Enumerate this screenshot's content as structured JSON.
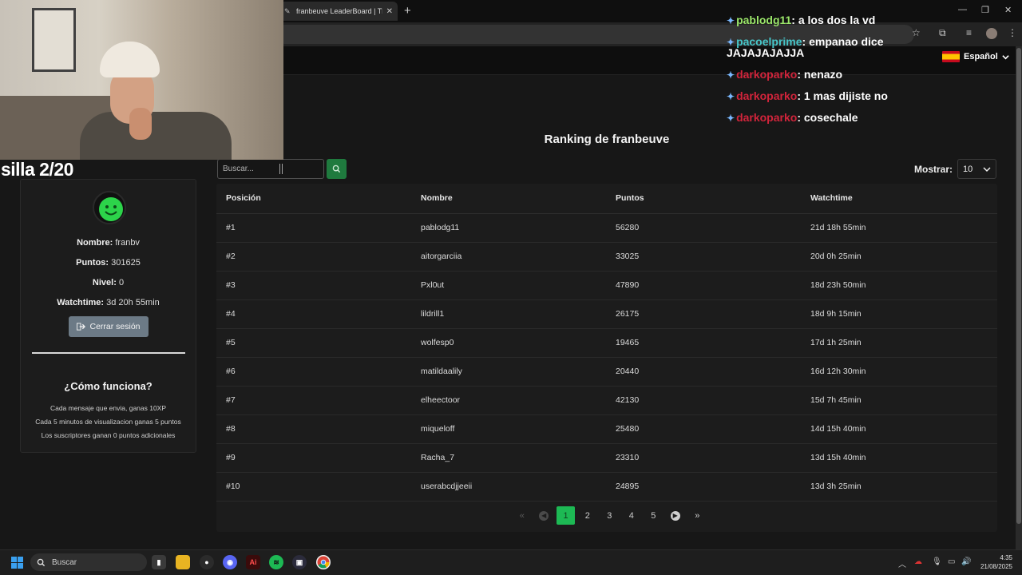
{
  "browser": {
    "tab_title": "franbeuve LeaderBoard | The b...",
    "tab_close": "✕",
    "new_tab": "+"
  },
  "navbar": {
    "language": "Español"
  },
  "overlay": {
    "label": "silla 2/20",
    "chat": [
      {
        "user": "pablodg11",
        "user_color": "#9be76a",
        "text": "a los dos la vd"
      },
      {
        "user": "pacoelprime",
        "user_color": "#46c6c9",
        "text": "empanao dice",
        "continued": "JAJAJAJAJJA"
      },
      {
        "user": "darkoparko",
        "user_color": "#d2243b",
        "text": "nenazo"
      },
      {
        "user": "darkoparko",
        "user_color": "#d2243b",
        "text": "1 mas dijiste no"
      },
      {
        "user": "darkoparko",
        "user_color": "#d2243b",
        "text": "cosechale"
      }
    ]
  },
  "profile": {
    "name_label": "Nombre:",
    "name": "franbv",
    "points_label": "Puntos:",
    "points": "301625",
    "level_label": "Nivel:",
    "level": "0",
    "watchtime_label": "Watchtime:",
    "watchtime": "3d 20h 55min",
    "logout_label": "Cerrar sesión",
    "how_title": "¿Cómo funciona?",
    "rules": [
      "Cada mensaje que envia, ganas 10XP",
      "Cada 5 minutos de visualizacion ganas 5 puntos",
      "Los suscriptores ganan 0 puntos adicionales"
    ]
  },
  "leaderboard": {
    "title": "Ranking de franbeuve",
    "search_placeholder": "Buscar...",
    "show_label": "Mostrar:",
    "show_value": "10",
    "columns": [
      "Posición",
      "Nombre",
      "Puntos",
      "Watchtime"
    ],
    "rows": [
      [
        "#1",
        "pablodg11",
        "56280",
        "21d 18h 55min"
      ],
      [
        "#2",
        "aitorgarciia",
        "33025",
        "20d 0h 25min"
      ],
      [
        "#3",
        "Pxl0ut",
        "47890",
        "18d 23h 50min"
      ],
      [
        "#4",
        "lildrill1",
        "26175",
        "18d 9h 15min"
      ],
      [
        "#5",
        "wolfesp0",
        "19465",
        "17d 1h 25min"
      ],
      [
        "#6",
        "matildaalily",
        "20440",
        "16d 12h 30min"
      ],
      [
        "#7",
        "elheectoor",
        "42130",
        "15d 7h 45min"
      ],
      [
        "#8",
        "miqueloff",
        "25480",
        "14d 15h 40min"
      ],
      [
        "#9",
        "Racha_7",
        "23310",
        "13d 15h 40min"
      ],
      [
        "#10",
        "userabcdjjeeii",
        "24895",
        "13d 3h 25min"
      ]
    ],
    "pages": [
      "1",
      "2",
      "3",
      "4",
      "5"
    ],
    "current_page": "1"
  },
  "taskbar": {
    "search_label": "Buscar",
    "time": "4:35",
    "date": "21/08/2025"
  },
  "colors": {
    "accent_green": "#1db954",
    "search_button": "#1f7a3e",
    "logout_button": "#6c7a86"
  }
}
